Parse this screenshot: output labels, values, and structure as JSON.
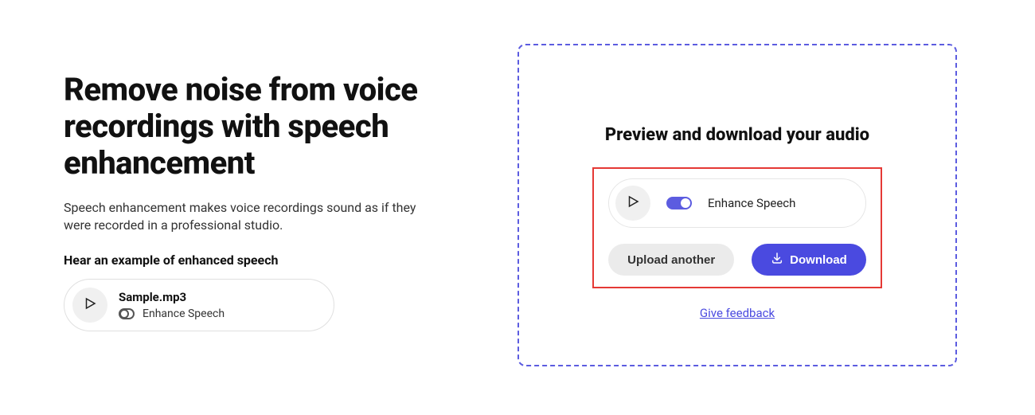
{
  "left": {
    "heading": "Remove noise from voice recordings with speech enhancement",
    "subtext": "Speech enhancement makes voice recordings sound as if they were recorded in a professional studio.",
    "example_label": "Hear an example of enhanced speech",
    "sample": {
      "filename": "Sample.mp3",
      "toggle_label": "Enhance Speech"
    }
  },
  "panel": {
    "title": "Preview and download your audio",
    "toggle_label": "Enhance Speech",
    "upload_another_label": "Upload another",
    "download_label": "Download",
    "feedback_label": "Give feedback"
  }
}
